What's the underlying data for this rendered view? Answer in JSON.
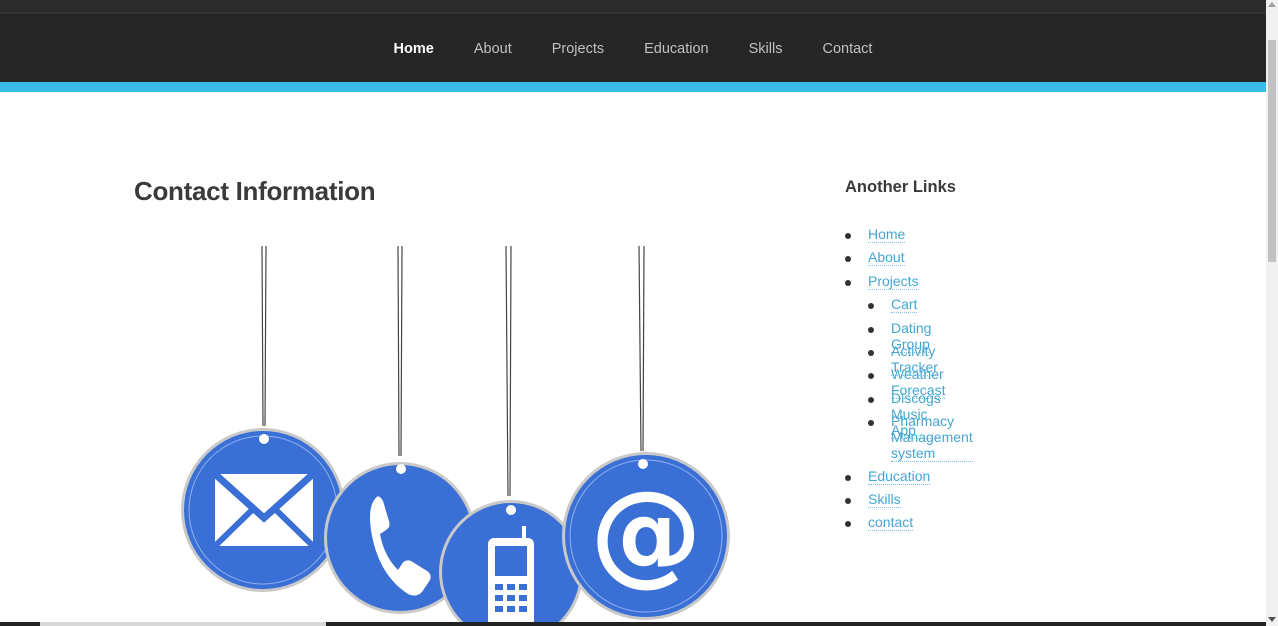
{
  "nav": {
    "items": [
      {
        "label": "Home",
        "active": true
      },
      {
        "label": "About"
      },
      {
        "label": "Projects"
      },
      {
        "label": "Education"
      },
      {
        "label": "Skills"
      },
      {
        "label": "Contact"
      }
    ]
  },
  "main": {
    "title": "Contact Information",
    "image_icons": [
      "envelope-icon",
      "phone-icon",
      "mobile-phone-icon",
      "at-sign-icon"
    ]
  },
  "sidebar": {
    "title": "Another Links",
    "links": {
      "home": "Home",
      "about": "About",
      "projects": "Projects",
      "cart": "Cart",
      "dating_group": "Dating Group",
      "activity_tracker": "Activity Tracker",
      "weather_forecast": "Weather Forecast",
      "discogs": "Discogs Music App",
      "pharmacy": "Pharmacy Management system",
      "education": "Education",
      "skills": "Skills",
      "contact": "contact"
    }
  },
  "colors": {
    "accent": "#39bbe8",
    "nav_bg": "#262626",
    "link": "#43a6d2",
    "icon_blue": "#3a6fd6"
  }
}
